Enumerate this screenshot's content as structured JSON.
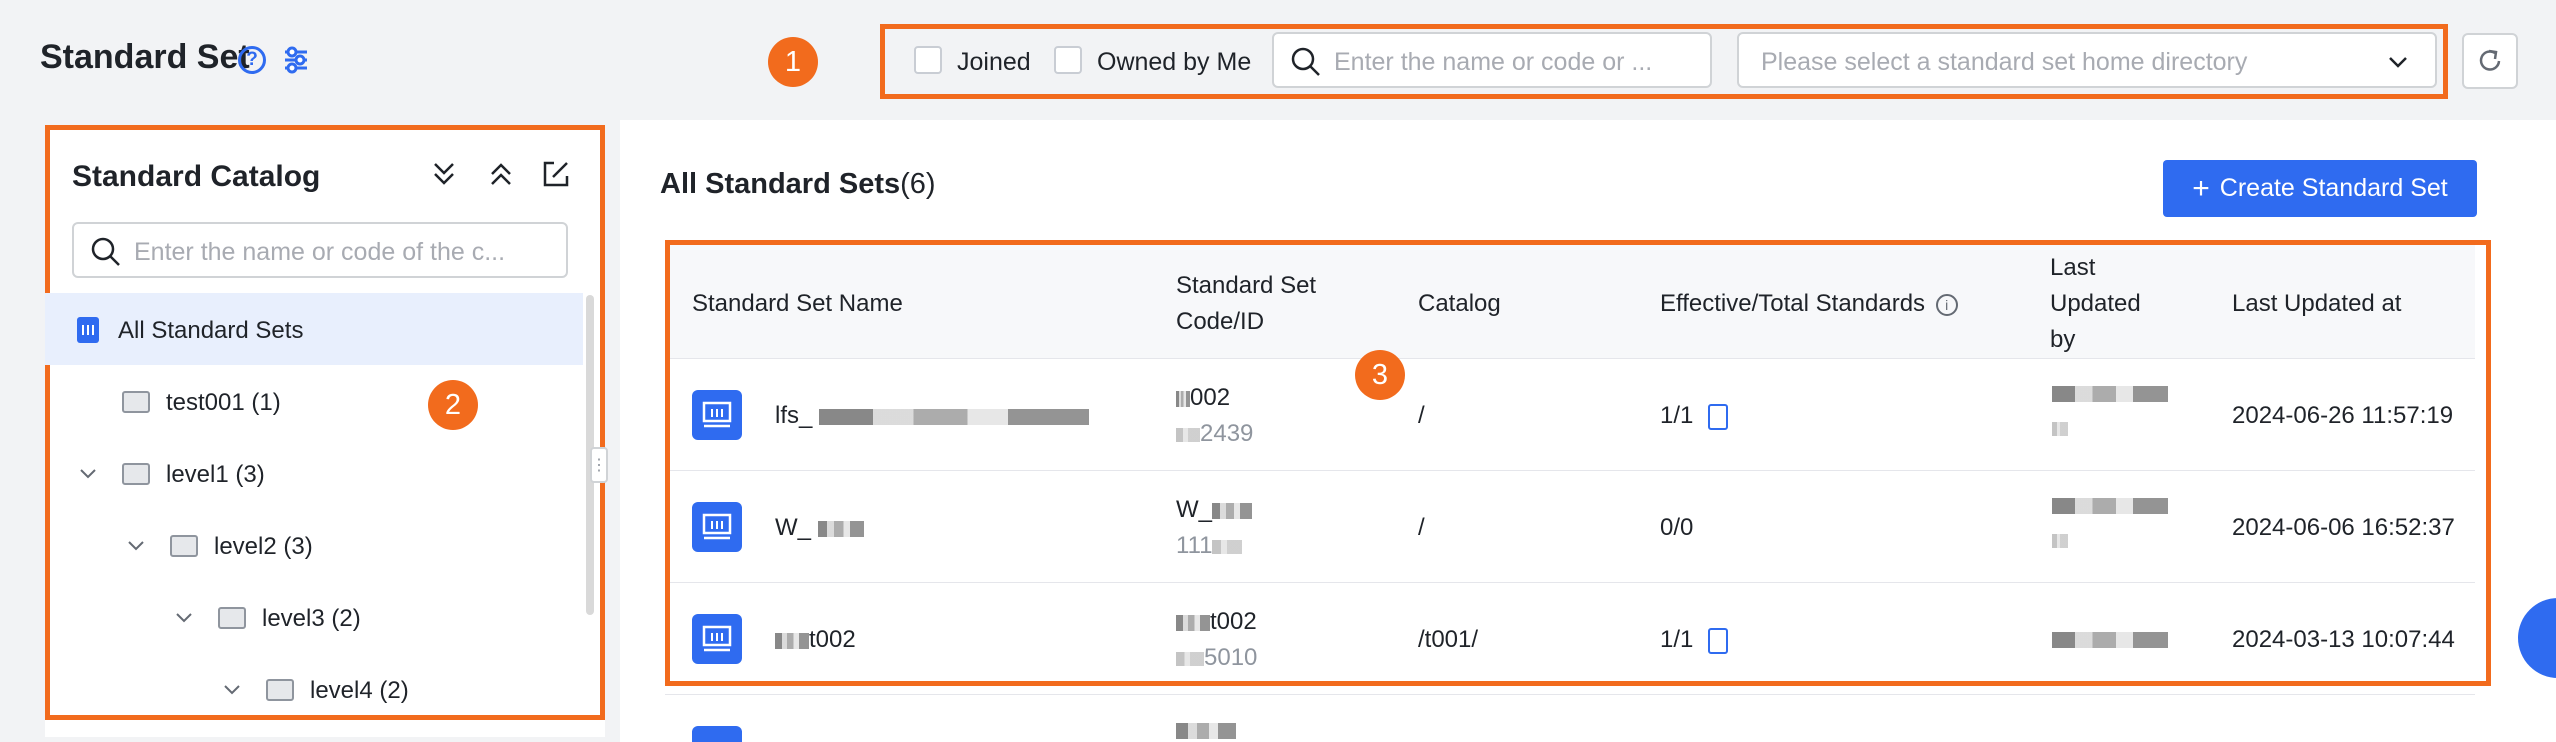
{
  "header": {
    "title": "Standard Set",
    "help_icon": "question-circle-icon",
    "filter_icon": "filter-settings-icon"
  },
  "badges": {
    "one": "1",
    "two": "2",
    "three": "3"
  },
  "filters": {
    "joined_label": "Joined",
    "owned_label": "Owned by Me",
    "search_placeholder": "Enter the name or code or ...",
    "directory_placeholder": "Please select a standard set home directory"
  },
  "catalog": {
    "title": "Standard Catalog",
    "search_placeholder": "Enter the name or code of the c...",
    "items": [
      {
        "label": "All Standard Sets",
        "level": 0,
        "selected": true
      },
      {
        "label": "test001",
        "count": "(1)",
        "level": 1
      },
      {
        "label": "level1",
        "count": "(3)",
        "level": 1,
        "expanded": true
      },
      {
        "label": "level2",
        "count": "(3)",
        "level": 2,
        "expanded": true
      },
      {
        "label": "level3",
        "count": "(2)",
        "level": 3,
        "expanded": true
      },
      {
        "label": "level4",
        "count": "(2)",
        "level": 4,
        "expanded": true
      }
    ]
  },
  "main": {
    "title": "All Standard Sets",
    "count": "(6)",
    "create_button": "Create Standard Set",
    "columns": {
      "name": "Standard Set Name",
      "code": "Standard Set Code/ID",
      "catalog": "Catalog",
      "effective": "Effective/Total Standards",
      "updated_by": "Last Updated by",
      "updated_at": "Last Updated at"
    },
    "rows": [
      {
        "name": "lfs_",
        "code": "002",
        "id": "2439",
        "catalog": "/",
        "effective": "1/1",
        "has_doc": true,
        "updated_at": "2024-06-26 11:57:19"
      },
      {
        "name": "W_",
        "code": "W_",
        "id": "111",
        "catalog": "/",
        "effective": "0/0",
        "has_doc": false,
        "updated_at": "2024-06-06 16:52:37"
      },
      {
        "name": "t002",
        "code": "t002",
        "id": "5010",
        "catalog": "/t001/",
        "effective": "1/1",
        "has_doc": true,
        "updated_at": "2024-03-13 10:07:44"
      }
    ]
  },
  "colors": {
    "accent": "#2f6bf0",
    "highlight": "#f26b1d"
  }
}
